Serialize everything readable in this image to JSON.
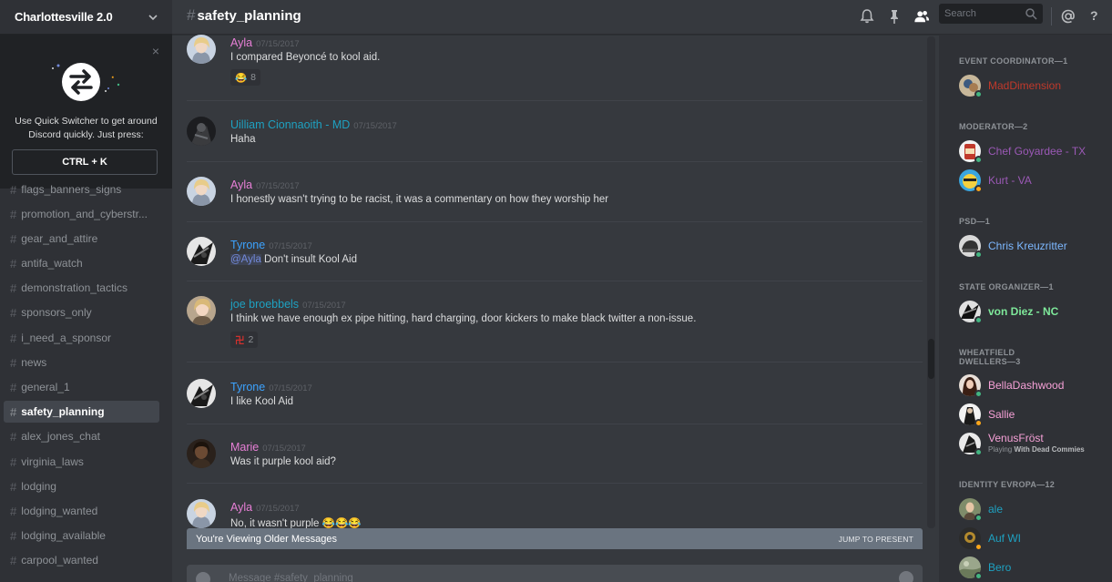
{
  "guild": {
    "name": "Charlottesville 2.0"
  },
  "quick_switcher": {
    "text": "Use Quick Switcher to get around Discord quickly. Just press:",
    "shortcut": "CTRL + K",
    "close": "×"
  },
  "channels": [
    {
      "name": "flags_banners_signs"
    },
    {
      "name": "promotion_and_cyberstr..."
    },
    {
      "name": "gear_and_attire"
    },
    {
      "name": "antifa_watch"
    },
    {
      "name": "demonstration_tactics"
    },
    {
      "name": "sponsors_only"
    },
    {
      "name": "i_need_a_sponsor"
    },
    {
      "name": "news"
    },
    {
      "name": "general_1"
    },
    {
      "name": "safety_planning",
      "active": true
    },
    {
      "name": "alex_jones_chat"
    },
    {
      "name": "virginia_laws"
    },
    {
      "name": "lodging"
    },
    {
      "name": "lodging_wanted"
    },
    {
      "name": "lodging_available"
    },
    {
      "name": "carpool_wanted"
    }
  ],
  "header": {
    "channel": "safety_planning",
    "hash": "#",
    "search_placeholder": "Search",
    "help": "?"
  },
  "messages": [
    {
      "author": "Ayla",
      "color": "#e77fd6",
      "time": "07/15/2017",
      "text": "I compared Beyoncé to kool aid.",
      "reaction": {
        "emoji": "😂",
        "count": "8"
      }
    },
    {
      "author": "Uilliam Cionnaoith - MD",
      "color": "#1ea1c1",
      "time": "07/15/2017",
      "text": "Haha"
    },
    {
      "author": "Ayla",
      "color": "#e77fd6",
      "time": "07/15/2017",
      "text": "I honestly wasn't trying to be racist, it was a commentary on how they worship her"
    },
    {
      "author": "Tyrone",
      "color": "#3ca3ff",
      "time": "07/15/2017",
      "mention": "@Ayla",
      "text": " Don't insult Kool Aid"
    },
    {
      "author": "joe broebbels",
      "color": "#1ea1c1",
      "time": "07/15/2017",
      "text": "I think we have enough ex pipe hitting, hard charging, door kickers to make black twitter a non-issue.",
      "reaction": {
        "emoji": "卍",
        "count": "2"
      }
    },
    {
      "author": "Tyrone",
      "color": "#3ca3ff",
      "time": "07/15/2017",
      "text": "I like Kool Aid"
    },
    {
      "author": "Marie",
      "color": "#e77fd6",
      "time": "07/15/2017",
      "text": "Was it purple kool aid?"
    },
    {
      "author": "Ayla",
      "color": "#e77fd6",
      "time": "07/15/2017",
      "text": "No, it wasn't purple 😂😂😂"
    }
  ],
  "older_bar": {
    "label": "You're Viewing Older Messages",
    "jump": "JUMP TO PRESENT"
  },
  "composer": {
    "placeholder": "Message #safety_planning"
  },
  "members": {
    "roles": [
      {
        "title": "EVENT COORDINATOR—1",
        "members": [
          {
            "name": "MadDimension",
            "color": "#c0392b",
            "status": "#43b581"
          }
        ]
      },
      {
        "title": "MODERATOR—2",
        "members": [
          {
            "name": "Chef Goyardee - TX",
            "color": "#9b59b6",
            "status": "#43b581"
          },
          {
            "name": "Kurt - VA",
            "color": "#9b59b6",
            "status": "#faa61a"
          }
        ]
      },
      {
        "title": "PSD—1",
        "members": [
          {
            "name": "Chris Kreuzritter",
            "color": "#7db8ff",
            "status": "#43b581"
          }
        ]
      },
      {
        "title": "STATE ORGANIZER—1",
        "members": [
          {
            "name": "von Diez - NC",
            "color": "#7ee89a",
            "status": "#43b581"
          }
        ]
      },
      {
        "title_lines": [
          "WHEATFIELD",
          "DWELLERS—3"
        ],
        "members": [
          {
            "name": "BellaDashwood",
            "color": "#f5a0d6",
            "status": "#43b581"
          },
          {
            "name": "Sallie",
            "color": "#f5a0d6",
            "status": "#faa61a"
          },
          {
            "name": "VenusFröst",
            "color": "#f5a0d6",
            "status": "#43b581",
            "game_prefix": "Playing ",
            "game": "With Dead Commies"
          }
        ]
      },
      {
        "title": "IDENTITY EVROPA—12",
        "members": [
          {
            "name": "ale",
            "color": "#1ea1c1",
            "status": "#43b581"
          },
          {
            "name": "Auf WI",
            "color": "#1ea1c1",
            "status": "#faa61a"
          },
          {
            "name": "Bero",
            "color": "#1ea1c1",
            "status": "#43b581"
          }
        ]
      }
    ]
  }
}
